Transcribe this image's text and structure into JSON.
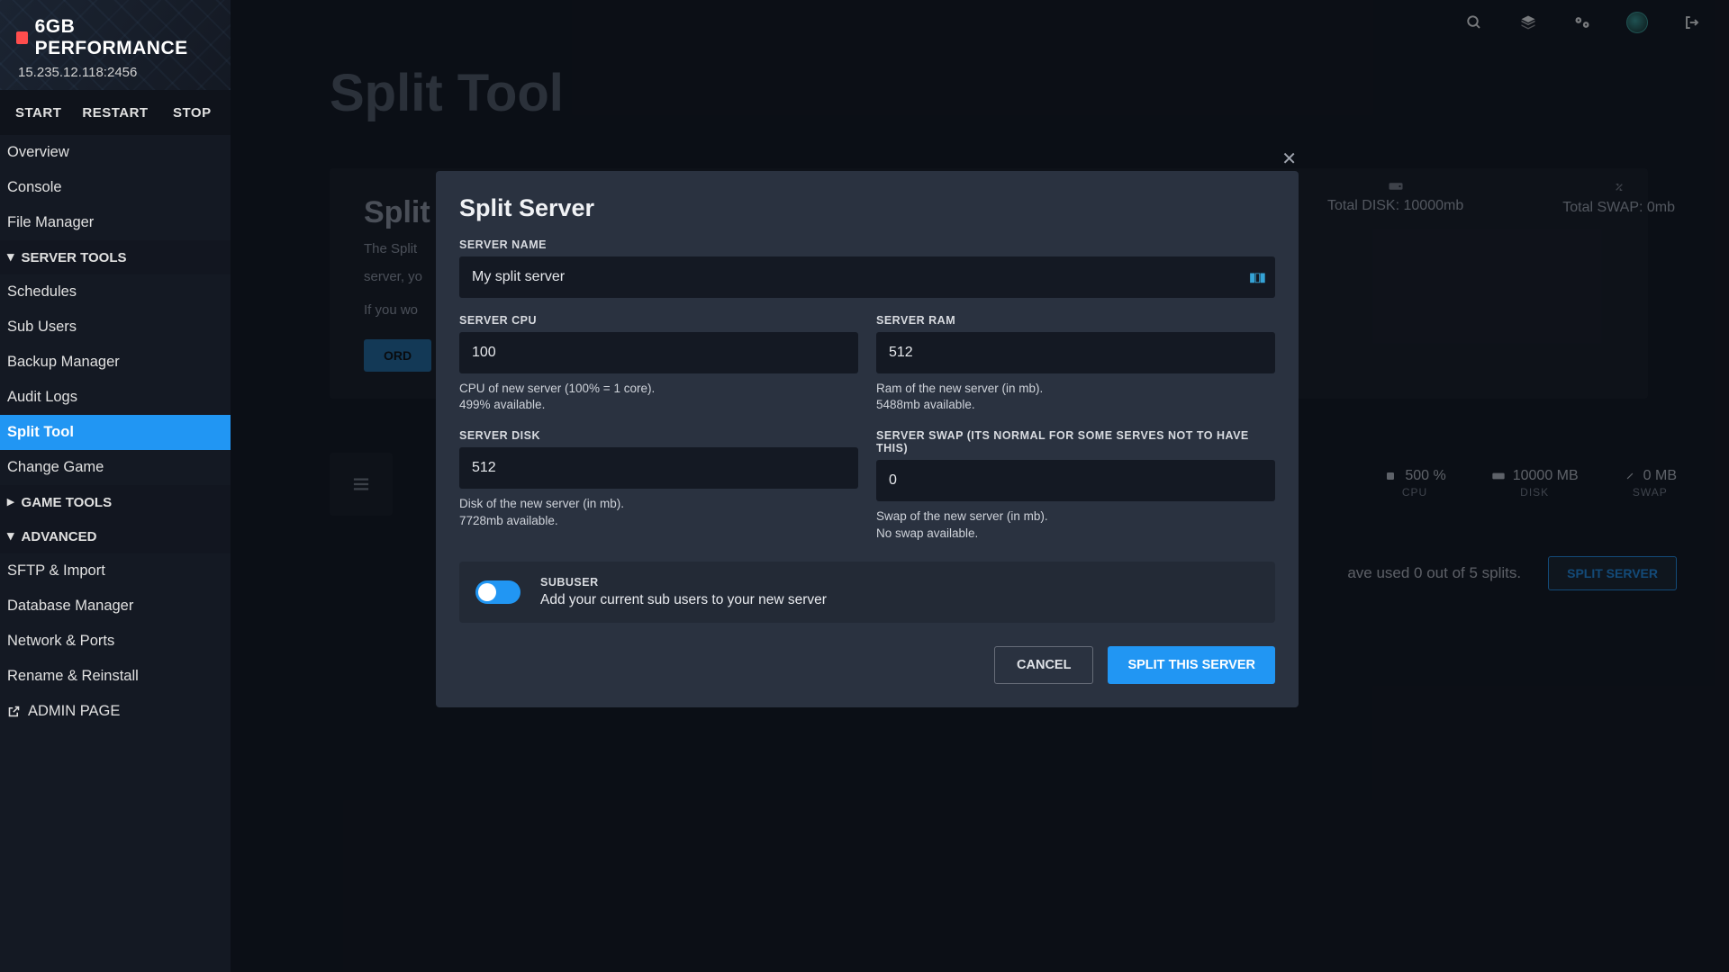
{
  "header": {
    "title": "6GB PERFORMANCE",
    "address": "15.235.12.118:2456"
  },
  "power": {
    "start": "START",
    "restart": "RESTART",
    "stop": "STOP"
  },
  "nav": {
    "overview": "Overview",
    "console": "Console",
    "file_manager": "File Manager",
    "server_tools": "SERVER TOOLS",
    "schedules": "Schedules",
    "sub_users": "Sub Users",
    "backup_manager": "Backup Manager",
    "audit_logs": "Audit Logs",
    "split_tool": "Split Tool",
    "change_game": "Change Game",
    "game_tools": "GAME TOOLS",
    "advanced": "ADVANCED",
    "sftp": "SFTP & Import",
    "db": "Database Manager",
    "network": "Network & Ports",
    "rename": "Rename & Reinstall",
    "admin": "ADMIN PAGE"
  },
  "main": {
    "title": "Split Tool",
    "panel_title": "Split",
    "panel_line1": "The Split",
    "panel_line2": "server, yo",
    "panel_line3": "If you wo",
    "order_btn": "ORD",
    "total_disk": "Total DISK: 10000mb",
    "total_swap": "Total SWAP: 0mb",
    "cpu_v": "500 %",
    "cpu_l": "CPU",
    "disk_v": "10000 MB",
    "disk_l": "DISK",
    "swap_v": "0 MB",
    "swap_l": "SWAP",
    "used_text": "ave used 0 out of 5 splits.",
    "split_server_btn": "SPLIT SERVER"
  },
  "modal": {
    "title": "Split Server",
    "name_label": "SERVER NAME",
    "name_value": "My split server",
    "cpu_label": "SERVER CPU",
    "cpu_value": "100",
    "cpu_help1": "CPU of new server (100% = 1 core).",
    "cpu_help2": "499% available.",
    "ram_label": "SERVER RAM",
    "ram_value": "512",
    "ram_help1": "Ram of the new server (in mb).",
    "ram_help2": "5488mb available.",
    "disk_label": "SERVER DISK",
    "disk_value": "512",
    "disk_help1": "Disk of the new server (in mb).",
    "disk_help2": "7728mb available.",
    "swap_label": "SERVER SWAP (ITS NORMAL FOR SOME SERVES NOT TO HAVE THIS)",
    "swap_value": "0",
    "swap_help1": "Swap of the new server (in mb).",
    "swap_help2": "No swap available.",
    "subuser_title": "SUBUSER",
    "subuser_desc": "Add your current sub users to your new server",
    "cancel": "CANCEL",
    "submit": "SPLIT THIS SERVER"
  }
}
